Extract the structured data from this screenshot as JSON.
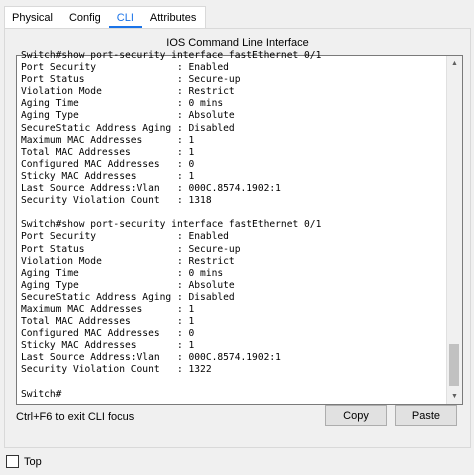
{
  "tabs": [
    {
      "label": "Physical"
    },
    {
      "label": "Config"
    },
    {
      "label": "CLI"
    },
    {
      "label": "Attributes"
    }
  ],
  "panel_title": "IOS Command Line Interface",
  "terminal_lines": [
    "Switch#show port-security interface fastEthernet 0/1",
    "Port Security              : Enabled",
    "Port Status                : Secure-up",
    "Violation Mode             : Restrict",
    "Aging Time                 : 0 mins",
    "Aging Type                 : Absolute",
    "SecureStatic Address Aging : Disabled",
    "Maximum MAC Addresses      : 1",
    "Total MAC Addresses        : 1",
    "Configured MAC Addresses   : 0",
    "Sticky MAC Addresses       : 1",
    "Last Source Address:Vlan   : 000C.8574.1902:1",
    "Security Violation Count   : 1318",
    "",
    "Switch#show port-security interface fastEthernet 0/1",
    "Port Security              : Enabled",
    "Port Status                : Secure-up",
    "Violation Mode             : Restrict",
    "Aging Time                 : 0 mins",
    "Aging Type                 : Absolute",
    "SecureStatic Address Aging : Disabled",
    "Maximum MAC Addresses      : 1",
    "Total MAC Addresses        : 1",
    "Configured MAC Addresses   : 0",
    "Sticky MAC Addresses       : 1",
    "Last Source Address:Vlan   : 000C.8574.1902:1",
    "Security Violation Count   : 1322",
    "",
    "Switch#"
  ],
  "hint": "Ctrl+F6 to exit CLI focus",
  "buttons": {
    "copy": "Copy",
    "paste": "Paste"
  },
  "top_checkbox": {
    "label": "Top",
    "checked": false
  },
  "colors": {
    "accent": "#1a73e8"
  }
}
